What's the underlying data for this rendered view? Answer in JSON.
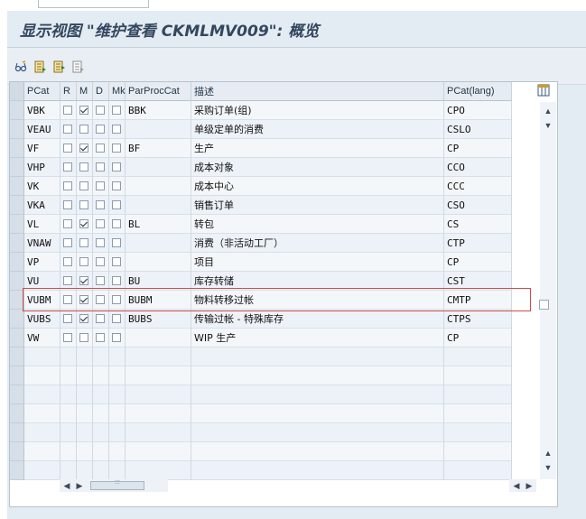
{
  "window": {
    "title": "显示视图 \"维护查看 CKMLMV009\": 概览"
  },
  "toolbar": {
    "icons": [
      "glasses-icon",
      "select-all-icon",
      "select-block-icon",
      "deselect-all-icon"
    ]
  },
  "table": {
    "columns": [
      "PCat",
      "R",
      "M",
      "D",
      "Mk",
      "ParProcCat",
      "描述",
      "PCat(lang)"
    ],
    "rows": [
      {
        "pcat": "VBK",
        "r": false,
        "m": true,
        "d": false,
        "mk": false,
        "parproc": "BBK",
        "desc": "采购订单(组)",
        "pcatlang": "CPO"
      },
      {
        "pcat": "VEAU",
        "r": false,
        "m": false,
        "d": false,
        "mk": false,
        "parproc": "",
        "desc": "单级定单的消费",
        "pcatlang": "CSLO"
      },
      {
        "pcat": "VF",
        "r": false,
        "m": true,
        "d": false,
        "mk": false,
        "parproc": "BF",
        "desc": "生产",
        "pcatlang": "CP"
      },
      {
        "pcat": "VHP",
        "r": false,
        "m": false,
        "d": false,
        "mk": false,
        "parproc": "",
        "desc": "成本对象",
        "pcatlang": "CCO"
      },
      {
        "pcat": "VK",
        "r": false,
        "m": false,
        "d": false,
        "mk": false,
        "parproc": "",
        "desc": "成本中心",
        "pcatlang": "CCC"
      },
      {
        "pcat": "VKA",
        "r": false,
        "m": false,
        "d": false,
        "mk": false,
        "parproc": "",
        "desc": "销售订单",
        "pcatlang": "CSO"
      },
      {
        "pcat": "VL",
        "r": false,
        "m": true,
        "d": false,
        "mk": false,
        "parproc": "BL",
        "desc": "转包",
        "pcatlang": "CS"
      },
      {
        "pcat": "VNAW",
        "r": false,
        "m": false,
        "d": false,
        "mk": false,
        "parproc": "",
        "desc": "消费（非活动工厂）",
        "pcatlang": "CTP"
      },
      {
        "pcat": "VP",
        "r": false,
        "m": false,
        "d": false,
        "mk": false,
        "parproc": "",
        "desc": "项目",
        "pcatlang": "CP"
      },
      {
        "pcat": "VU",
        "r": false,
        "m": true,
        "d": false,
        "mk": false,
        "parproc": "BU",
        "desc": "库存转储",
        "pcatlang": "CST"
      },
      {
        "pcat": "VUBM",
        "r": false,
        "m": true,
        "d": false,
        "mk": false,
        "parproc": "BUBM",
        "desc": "物料转移过帐",
        "pcatlang": "CMTP"
      },
      {
        "pcat": "VUBS",
        "r": false,
        "m": true,
        "d": false,
        "mk": false,
        "parproc": "BUBS",
        "desc": "传输过帐 - 特殊库存",
        "pcatlang": "CTPS"
      },
      {
        "pcat": "VW",
        "r": false,
        "m": false,
        "d": false,
        "mk": false,
        "parproc": "",
        "desc": "WIP 生产",
        "pcatlang": "CP"
      }
    ],
    "empty_rows": 7,
    "highlighted_row": "VUBM"
  },
  "scroll": {
    "hthumb_glyph": ":::"
  },
  "colors": {
    "panel_bg": "#e3ebf3",
    "title_text": "#33475e",
    "highlight_border": "#d24a4a"
  }
}
